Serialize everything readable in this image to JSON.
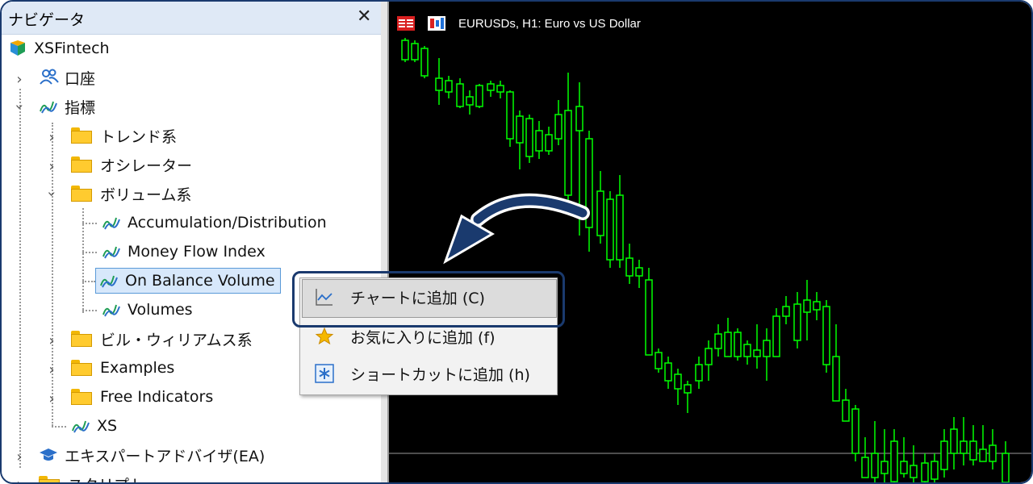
{
  "navigator": {
    "title": "ナビゲータ",
    "close_glyph": "✕",
    "root": "XSFintech",
    "items": {
      "account": "口座",
      "indicators": "指標",
      "trend": "トレンド系",
      "oscillator": "オシレーター",
      "volume": "ボリューム系",
      "acc_dist": "Accumulation/Distribution",
      "mfi": "Money Flow Index",
      "obv": "On Balance Volume",
      "volumes": "Volumes",
      "bill_williams": "ビル・ウィリアムス系",
      "examples": "Examples",
      "free_indicators": "Free Indicators",
      "xs": "XS",
      "ea": "エキスパートアドバイザ(EA)",
      "scripts": "スクリプト"
    }
  },
  "chart": {
    "title": "EURUSDs, H1:  Euro vs US Dollar",
    "candle_color": "#00ff00",
    "background": "#000000"
  },
  "context_menu": {
    "add_to_chart": "チャートに追加 (C)",
    "add_to_favorites": "お気に入りに追加 (f)",
    "add_shortcut": "ショートカットに追加 (h)"
  },
  "colors": {
    "accent": "#1a3a6e",
    "selection": "#d7e8fb",
    "folder": "#ffcb2f"
  }
}
